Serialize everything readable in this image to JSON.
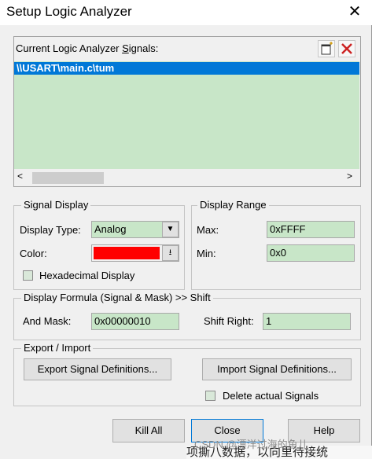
{
  "window": {
    "title": "Setup Logic Analyzer",
    "close_glyph": "✕"
  },
  "signals": {
    "label_prefix": "Current Logic Analyzer ",
    "label_underlined": "S",
    "label_suffix": "ignals:",
    "items": [
      "\\\\USART\\main.c\\tum"
    ],
    "new_icon": "new-item-icon",
    "delete_icon": "delete-x-icon",
    "delete_color": "#cc2222",
    "scroll_left": "<",
    "scroll_right": ">"
  },
  "signal_display": {
    "title": "Signal Display",
    "display_type_label": "Display Type:",
    "display_type_value": "Analog",
    "color_label": "Color:",
    "color_value": "#ff0000",
    "hex_label": "Hexadecimal Display",
    "hex_checked": false
  },
  "display_range": {
    "title": "Display Range",
    "max_label": "Max:",
    "max_value": "0xFFFF",
    "min_label": "Min:",
    "min_value": "0x0"
  },
  "formula": {
    "title": "Display Formula (Signal & Mask) >> Shift",
    "and_mask_label": "And Mask:",
    "and_mask_value": "0x00000010",
    "shift_label": "Shift Right:",
    "shift_value": "1"
  },
  "export_import": {
    "title": "Export / Import",
    "export_label": "Export Signal Definitions...",
    "import_label": "Import Signal Definitions...",
    "delete_actual_label": "Delete actual Signals",
    "delete_actual_checked": false
  },
  "buttons": {
    "kill_all": "Kill All",
    "close": "Close",
    "help": "Help"
  },
  "watermark": "CSDN @漂洋过海的鱼儿",
  "background_text": "项撕八数据，以向里待接统"
}
